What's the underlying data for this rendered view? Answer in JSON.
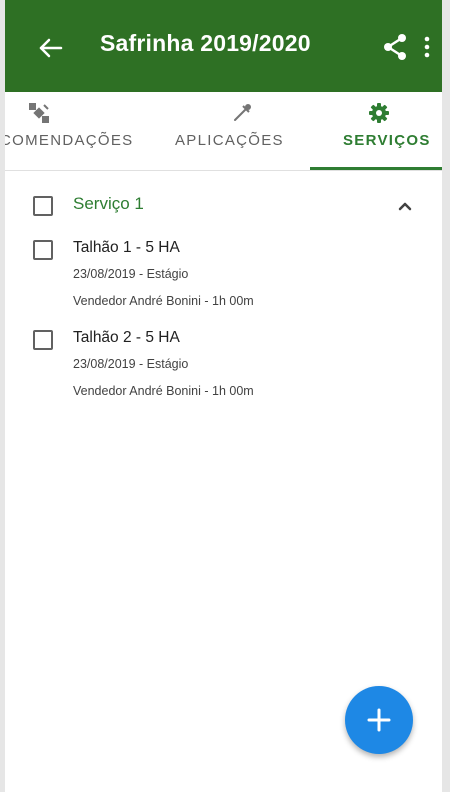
{
  "appbar": {
    "title": "Safrinha 2019/2020",
    "back_icon": "arrow-left-icon",
    "share_icon": "share-icon",
    "more_icon": "more-vert-icon"
  },
  "tabs": [
    {
      "label": "COMENDAÇÕES",
      "icon": "satellite-icon",
      "active": false
    },
    {
      "label": "APLICAÇÕES",
      "icon": "dropper-icon",
      "active": false
    },
    {
      "label": "SERVIÇOS",
      "icon": "gear-icon",
      "active": true
    }
  ],
  "service": {
    "title": "Serviço 1",
    "expanded": true,
    "items": [
      {
        "title": "Talhão 1 - 5 HA",
        "date_stage": "23/08/2019 - Estágio",
        "vendor": "Vendedor  André Bonini - 1h 00m"
      },
      {
        "title": "Talhão 2 - 5 HA",
        "date_stage": "23/08/2019 - Estágio",
        "vendor": "Vendedor  André Bonini - 1h 00m"
      }
    ]
  },
  "fab": {
    "icon": "plus-icon"
  },
  "colors": {
    "primary": "#2e7024",
    "accent_green": "#2e7d32",
    "fab_blue": "#1e88e5"
  }
}
